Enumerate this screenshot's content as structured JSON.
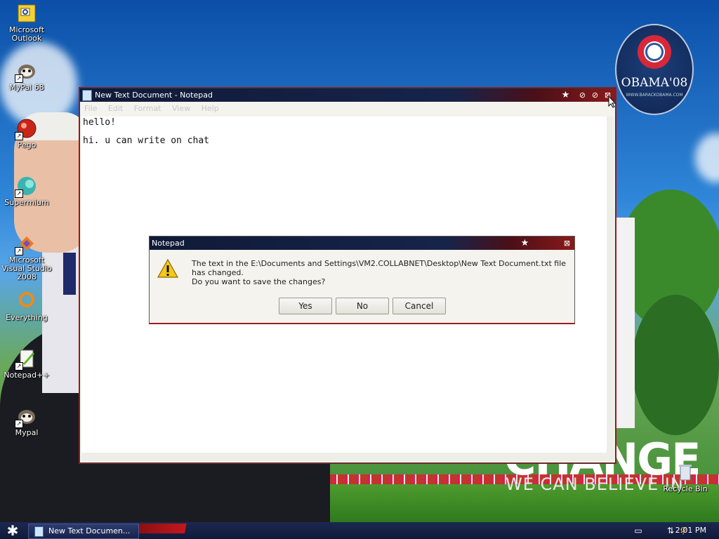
{
  "desktop": {
    "icons": [
      {
        "label": "Microsoft Outlook",
        "icon": "outlook-icon"
      },
      {
        "label": "MyPal 68",
        "icon": "mypal-icon"
      },
      {
        "label": "Pego",
        "icon": "pego-icon"
      },
      {
        "label": "Supermium",
        "icon": "supermium-icon"
      },
      {
        "label": "Microsoft Visual Studio 2008",
        "icon": "visual-studio-icon"
      },
      {
        "label": "Everything",
        "icon": "everything-icon"
      },
      {
        "label": "Notepad++",
        "icon": "notepadpp-icon"
      },
      {
        "label": "Mypal",
        "icon": "mypal-icon"
      }
    ],
    "recycle_bin": {
      "label": "Recycle Bin",
      "icon": "recycle-bin-icon"
    },
    "wallpaper": {
      "change_text": "CHANGE",
      "sub_text": "WE CAN BELIEVE IN",
      "logo_text": "OBAMA'08",
      "logo_subtext": "WWW.BARACKOBAMA.COM"
    }
  },
  "notepad": {
    "title": "New Text Document - Notepad",
    "menu": [
      "File",
      "Edit",
      "Format",
      "View",
      "Help"
    ],
    "content": "hello!\n\nhi. u can write on chat",
    "controls": {
      "star": "★",
      "minimize": "⊘",
      "maximize": "⊘",
      "close": "⊠"
    }
  },
  "dialog": {
    "title": "Notepad",
    "message_line1": "The text in the E:\\Documents and Settings\\VM2.COLLABNET\\Desktop\\New Text Document.txt file has changed.",
    "message_line2": "Do you want to save the changes?",
    "buttons": {
      "yes": "Yes",
      "no": "No",
      "cancel": "Cancel"
    },
    "icon": "warning-icon"
  },
  "taskbar": {
    "start_glyph": "✱",
    "task_label": "New Text Documen...",
    "clock": "2:01 PM"
  },
  "colors": {
    "titlebar_dark": "#101a38",
    "titlebar_red": "#8a1a1a",
    "taskbar": "#0f1a3a"
  }
}
